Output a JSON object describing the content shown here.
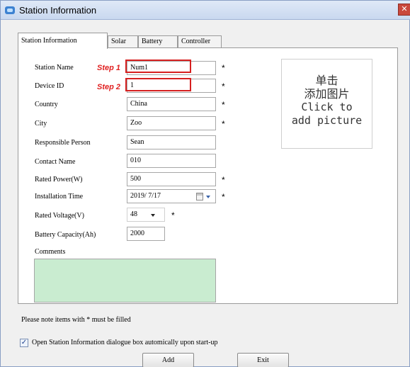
{
  "window": {
    "title": "Station Information",
    "close_glyph": "✕"
  },
  "tabs": [
    {
      "label": "Station Information",
      "active": true
    },
    {
      "label": "Solar",
      "active": false
    },
    {
      "label": "Battery",
      "active": false
    },
    {
      "label": "Controller",
      "active": false
    }
  ],
  "form": {
    "station_name": {
      "label": "Station Name",
      "value": "Num1",
      "required": "*",
      "step": "Step 1"
    },
    "device_id": {
      "label": "Device ID",
      "value": "1",
      "required": "*",
      "step": "Step 2"
    },
    "country": {
      "label": "Country",
      "value": "China",
      "required": "*"
    },
    "city": {
      "label": "City",
      "value": "Zoo",
      "required": "*"
    },
    "responsible_person": {
      "label": "Responsible Person",
      "value": "Sean"
    },
    "contact_name": {
      "label": "Contact Name",
      "value": "010"
    },
    "rated_power": {
      "label": "Rated Power(W)",
      "value": "500",
      "required": "*"
    },
    "installation_time": {
      "label": "Installation Time",
      "value": "2019/ 7/17",
      "required": "*"
    },
    "rated_voltage": {
      "label": "Rated Voltage(V)",
      "value": "48",
      "required": "*"
    },
    "battery_capacity": {
      "label": "Battery Capacity(Ah)",
      "value": "2000"
    },
    "comments": {
      "label": "Comments",
      "value": ""
    }
  },
  "picture": {
    "line1_zh": "单击",
    "line2_zh": "添加图片",
    "line3": "Click to",
    "line4": "add picture"
  },
  "note": "Please note items with * must be filled",
  "startup_checkbox": {
    "checked": true,
    "glyph": "✓",
    "label": "Open Station Information dialogue box automically upon start-up"
  },
  "buttons": {
    "add": "Add",
    "exit": "Exit"
  },
  "colors": {
    "step_red": "#e02020",
    "comments_bg": "#c9ecd0",
    "titlebar": "#c9d8ef"
  }
}
